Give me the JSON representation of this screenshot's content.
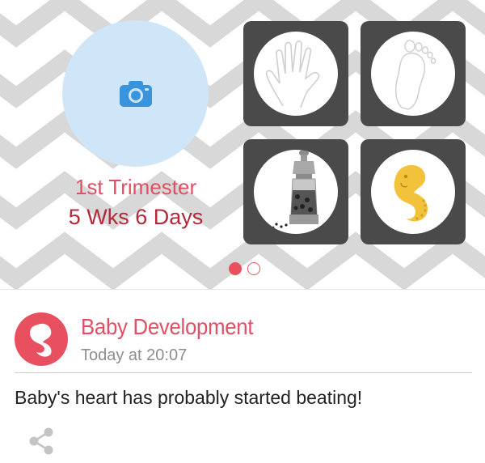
{
  "hero": {
    "trimester": "1st Trimester",
    "weeks": "5 Wks 6 Days",
    "pager": {
      "count": 2,
      "active": 1
    },
    "tiles": [
      {
        "name": "handprint",
        "icon": "hand-icon"
      },
      {
        "name": "footprint",
        "icon": "foot-icon"
      },
      {
        "name": "size-comparison",
        "icon": "pepper-grinder-icon"
      },
      {
        "name": "fetus",
        "icon": "fetus-icon"
      }
    ]
  },
  "card": {
    "title": "Baby Development",
    "time": "Today at 20:07",
    "message": "Baby's heart has probably started beating!",
    "avatar_icon": "fetus-icon",
    "share_icon": "share-icon"
  },
  "colors": {
    "accent": "#e8505f",
    "trimester_text": "#e05064",
    "weeks_text": "#b4283a",
    "photo_circle": "#cfe6f9",
    "camera": "#3a93dd",
    "tile_bg": "#4a4a4a",
    "pattern": "#cfcfcf"
  }
}
